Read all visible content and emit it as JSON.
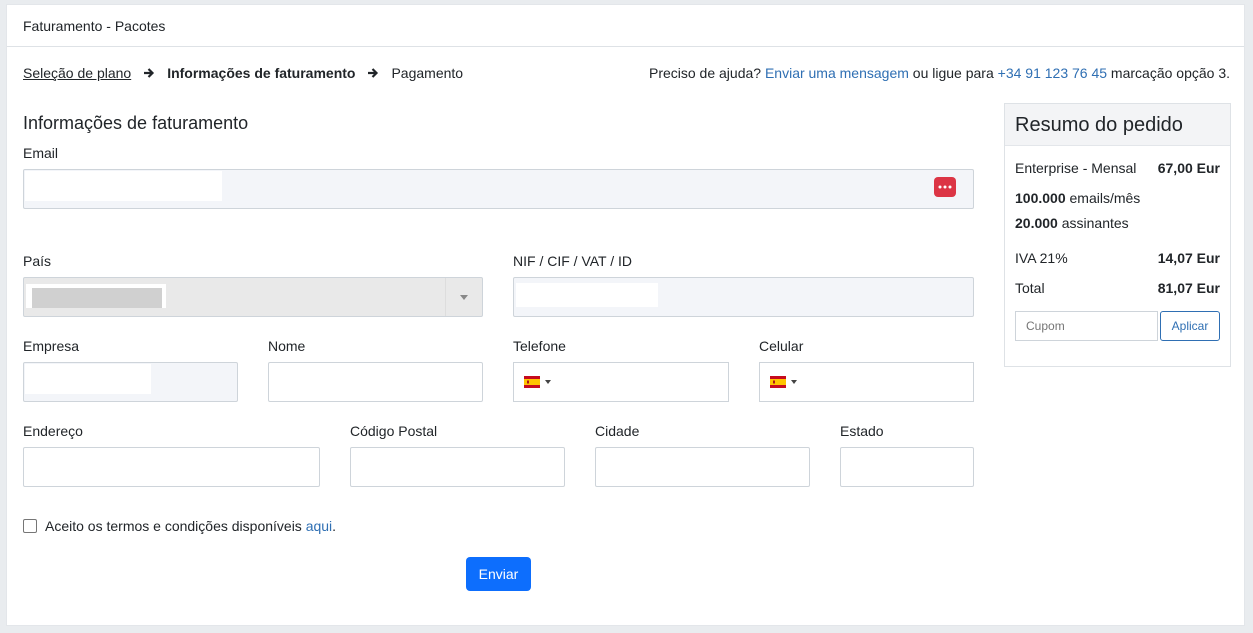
{
  "window": {
    "title": "Faturamento - Pacotes"
  },
  "breadcrumb": {
    "step1": "Seleção de plano",
    "step2": "Informações de faturamento",
    "step3": "Pagamento"
  },
  "help": {
    "prefix": "Preciso de ajuda?",
    "message_link": "Enviar uma mensagem",
    "middle": "ou ligue para",
    "phone_link": "+34 91 123 76 45",
    "suffix": "marcação opção 3."
  },
  "form": {
    "title": "Informações de faturamento",
    "email_label": "Email",
    "country_label": "País",
    "taxid_label": "NIF / CIF / VAT / ID",
    "company_label": "Empresa",
    "name_label": "Nome",
    "phone_label": "Telefone",
    "mobile_label": "Celular",
    "address_label": "Endereço",
    "postal_label": "Código Postal",
    "city_label": "Cidade",
    "state_label": "Estado",
    "terms_text": "Aceito os termos e condições disponíveis",
    "terms_link": "aqui",
    "terms_end": ".",
    "submit_label": "Enviar"
  },
  "summary": {
    "title": "Resumo do pedido",
    "plan_label": "Enterprise - Mensal",
    "plan_price": "67,00 Eur",
    "emails_count": "100.000",
    "emails_text": "emails/mês",
    "subs_count": "20.000",
    "subs_text": "assinantes",
    "tax_label": "IVA 21%",
    "tax_value": "14,07 Eur",
    "total_label": "Total",
    "total_value": "81,07 Eur",
    "coupon_placeholder": "Cupom",
    "apply_label": "Aplicar"
  },
  "colors": {
    "link": "#2f6fb3",
    "primary": "#0d6efd",
    "password_icon": "#dc3545"
  }
}
